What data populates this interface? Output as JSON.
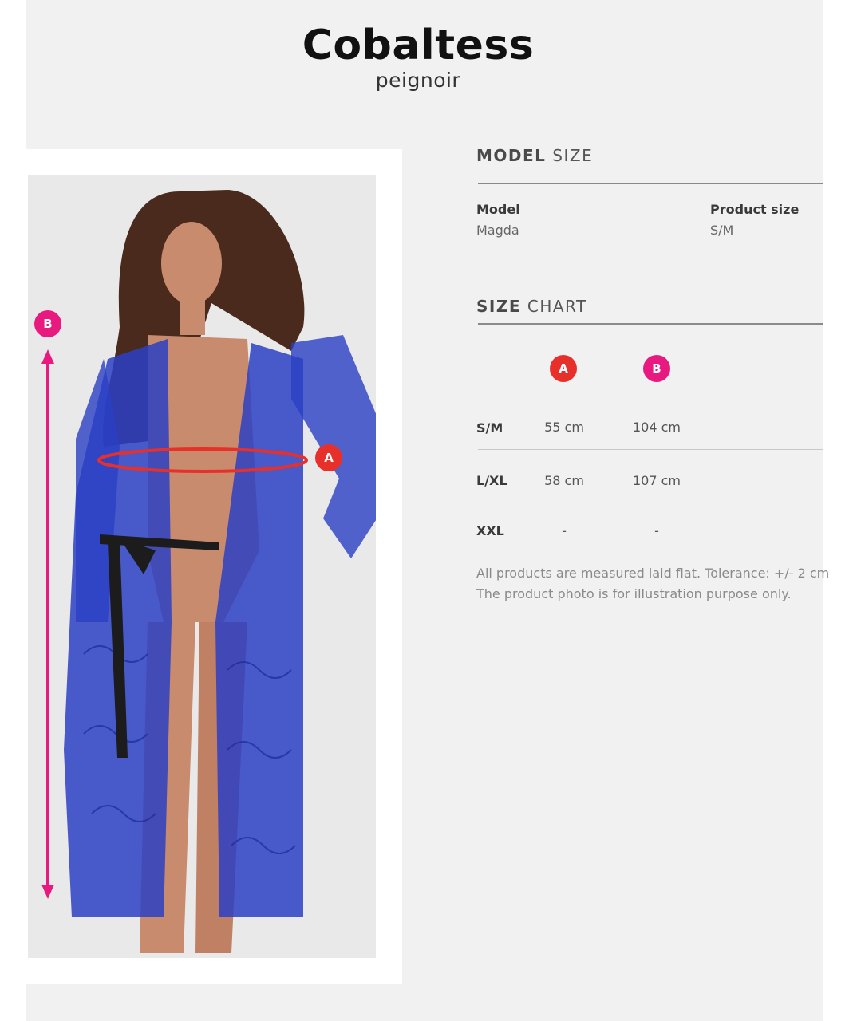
{
  "product": {
    "name": "Cobaltess",
    "type": "peignoir"
  },
  "colors": {
    "badge_a": "#e8302b",
    "badge_b": "#e8197f",
    "lace": "#2b3fc4",
    "ribbon": "#1c1c1c"
  },
  "model_size": {
    "heading_bold": "MODEL",
    "heading_light": "SIZE",
    "model_label": "Model",
    "model_value": "Magda",
    "size_label": "Product size",
    "size_value": "S/M"
  },
  "size_chart": {
    "heading_bold": "SIZE",
    "heading_light": "CHART",
    "columns": [
      "A",
      "B"
    ],
    "rows": [
      {
        "size": "S/M",
        "a": "55 cm",
        "b": "104 cm"
      },
      {
        "size": "L/XL",
        "a": "58 cm",
        "b": "107 cm"
      },
      {
        "size": "XXL",
        "a": "-",
        "b": "-"
      }
    ],
    "note_line1": "All products are measured laid flat. Tolerance: +/- 2 cm",
    "note_line2": "The product photo is for illustration purpose only."
  },
  "photo_markers": {
    "a": "A",
    "b": "B"
  }
}
